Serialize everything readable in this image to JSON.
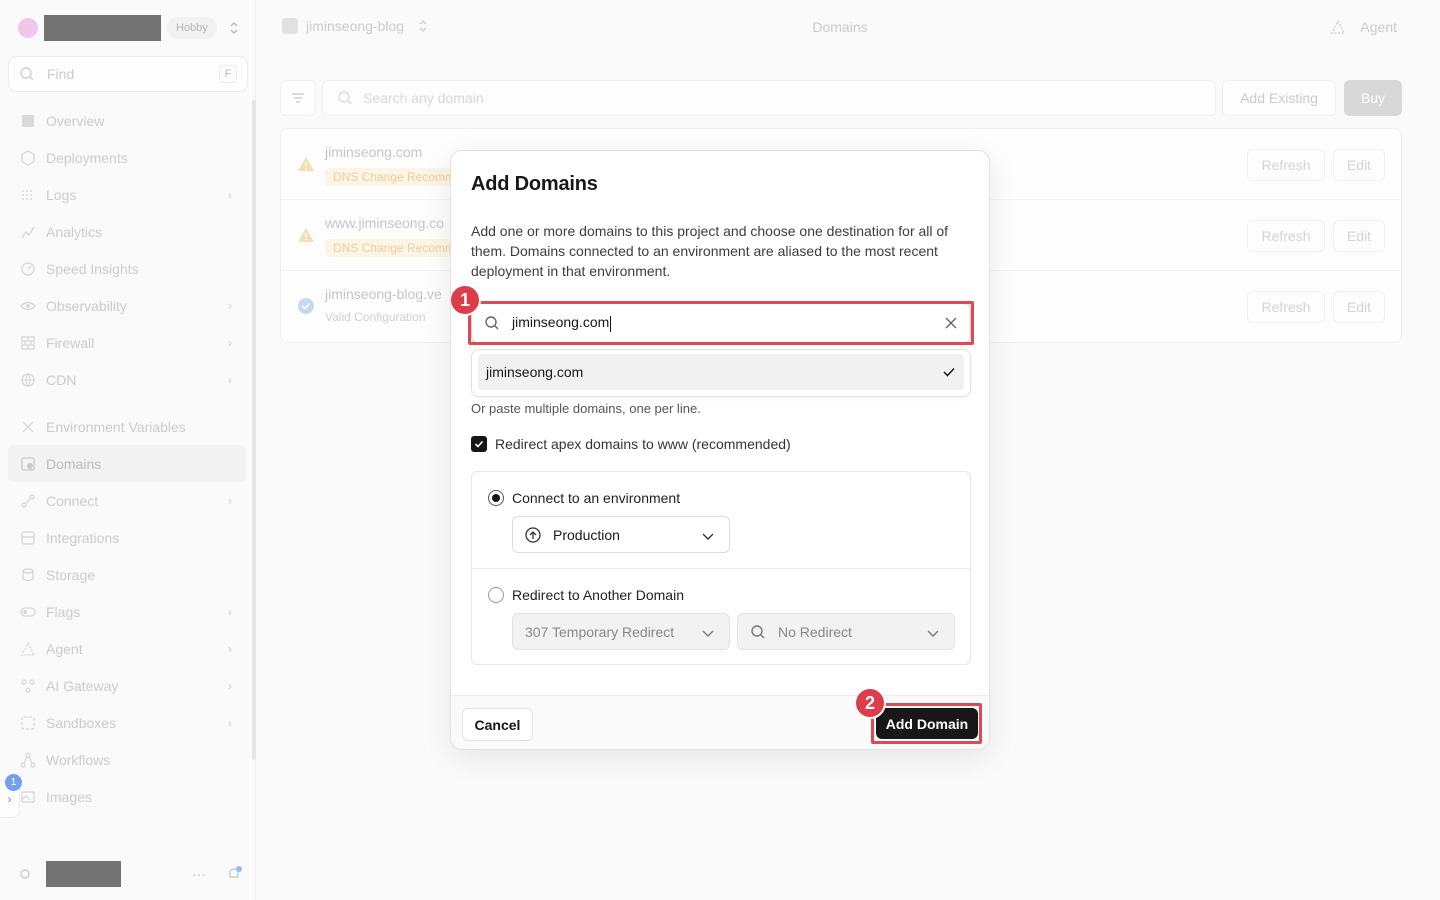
{
  "sidebar": {
    "plan_badge": "Hobby",
    "find_placeholder": "Find",
    "find_shortcut": "F",
    "items": [
      {
        "label": "Overview"
      },
      {
        "label": "Deployments"
      },
      {
        "label": "Logs"
      },
      {
        "label": "Analytics"
      },
      {
        "label": "Speed Insights"
      },
      {
        "label": "Observability"
      },
      {
        "label": "Firewall"
      },
      {
        "label": "CDN"
      },
      {
        "label": "Environment Variables"
      },
      {
        "label": "Domains"
      },
      {
        "label": "Connect"
      },
      {
        "label": "Integrations"
      },
      {
        "label": "Storage"
      },
      {
        "label": "Flags"
      },
      {
        "label": "Agent"
      },
      {
        "label": "AI Gateway"
      },
      {
        "label": "Sandboxes"
      },
      {
        "label": "Workflows"
      },
      {
        "label": "Images"
      }
    ],
    "notification_count": "1",
    "more": "···"
  },
  "topbar": {
    "project": "jiminseong-blog",
    "page_title": "Domains",
    "agent": "Agent"
  },
  "toolbar": {
    "search_placeholder": "Search any domain",
    "add_existing": "Add Existing",
    "buy": "Buy"
  },
  "domains": [
    {
      "name": "jiminseong.com",
      "status": "DNS Change Recomm",
      "refresh": "Refresh",
      "edit": "Edit"
    },
    {
      "name": "www.jiminseong.co",
      "status": "DNS Change Recomm",
      "refresh": "Refresh",
      "edit": "Edit"
    },
    {
      "name": "jiminseong-blog.ve",
      "status": "Valid Configuration",
      "refresh": "Refresh",
      "edit": "Edit"
    }
  ],
  "modal": {
    "title": "Add Domains",
    "description": "Add one or more domains to this project and choose one destination for all of them. Domains connected to an environment are aliased to the most recent deployment in that environment.",
    "input_value": "jiminseong.com",
    "suggestion": "jiminseong.com",
    "paste_hint": "Or paste multiple domains, one per line.",
    "redirect_apex_label": "Redirect apex domains to www (recommended)",
    "connect_env_label": "Connect to an environment",
    "environment": "Production",
    "redirect_domain_label": "Redirect to Another Domain",
    "redirect_type": "307 Temporary Redirect",
    "redirect_target": "No Redirect",
    "cancel": "Cancel",
    "add": "Add Domain"
  },
  "annotations": {
    "step1": "1",
    "step2": "2"
  },
  "colors": {
    "highlight": "#de4a54",
    "badge": "#dc3d4a",
    "primary": "#171717"
  }
}
